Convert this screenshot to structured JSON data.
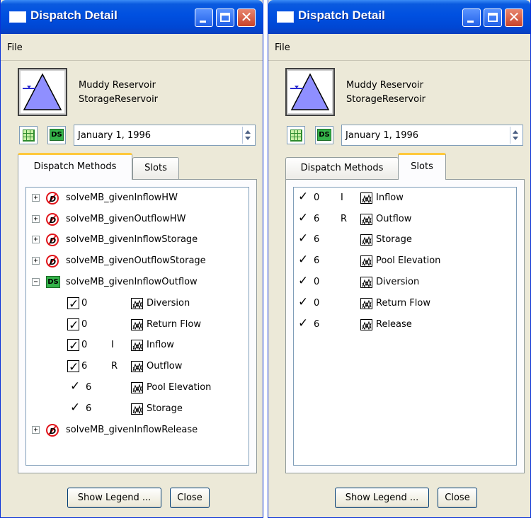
{
  "windows": [
    {
      "title": "Dispatch Detail",
      "menu": {
        "file_label": "File"
      },
      "object": {
        "name": "Muddy Reservoir",
        "type": "StorageReservoir"
      },
      "ds_label": "DS",
      "date": "January 1, 1996",
      "tabs": [
        {
          "label": "Dispatch Methods",
          "active": true
        },
        {
          "label": "Slots",
          "active": false
        }
      ],
      "tree": {
        "methods": [
          {
            "label": "solveMB_givenInflowHW",
            "expanded": false,
            "active": false
          },
          {
            "label": "solveMB_givenOutflowHW",
            "expanded": false,
            "active": false
          },
          {
            "label": "solveMB_givenInflowStorage",
            "expanded": false,
            "active": false
          },
          {
            "label": "solveMB_givenOutflowStorage",
            "expanded": false,
            "active": false
          },
          {
            "label": "solveMB_givenInflowOutflow",
            "expanded": true,
            "active": true
          },
          {
            "label": "solveMB_givenInflowRelease",
            "expanded": false,
            "active": false
          }
        ],
        "child_slots": [
          {
            "num": "0",
            "flag": "",
            "name": "Diversion",
            "boxed": true
          },
          {
            "num": "0",
            "flag": "",
            "name": "Return Flow",
            "boxed": true
          },
          {
            "num": "0",
            "flag": "I",
            "name": "Inflow",
            "boxed": true
          },
          {
            "num": "6",
            "flag": "R",
            "name": "Outflow",
            "boxed": true
          },
          {
            "num": "6",
            "flag": "",
            "name": "Pool Elevation",
            "boxed": false
          },
          {
            "num": "6",
            "flag": "",
            "name": "Storage",
            "boxed": false
          }
        ]
      },
      "buttons": {
        "legend": "Show Legend ...",
        "close": "Close"
      }
    },
    {
      "title": "Dispatch Detail",
      "menu": {
        "file_label": "File"
      },
      "object": {
        "name": "Muddy Reservoir",
        "type": "StorageReservoir"
      },
      "ds_label": "DS",
      "date": "January 1, 1996",
      "tabs": [
        {
          "label": "Dispatch Methods",
          "active": false
        },
        {
          "label": "Slots",
          "active": true
        }
      ],
      "slots": [
        {
          "num": "0",
          "flag": "I",
          "name": "Inflow"
        },
        {
          "num": "6",
          "flag": "R",
          "name": "Outflow"
        },
        {
          "num": "6",
          "flag": "",
          "name": "Storage"
        },
        {
          "num": "6",
          "flag": "",
          "name": "Pool Elevation"
        },
        {
          "num": "0",
          "flag": "",
          "name": "Diversion"
        },
        {
          "num": "0",
          "flag": "",
          "name": "Return Flow"
        },
        {
          "num": "6",
          "flag": "",
          "name": "Release"
        }
      ],
      "buttons": {
        "legend": "Show Legend ...",
        "close": "Close"
      }
    }
  ],
  "icons": {
    "check": "check-mark-icon",
    "slot": "series-slot-icon",
    "method_inactive": "no-dispatch-icon",
    "method_active": "ds-icon",
    "reservoir": "reservoir-triangle-icon",
    "grid": "grid-icon"
  },
  "colors": {
    "title_bar": "#0050e0",
    "close_button": "#c8432a",
    "ds_green": "#34b34a",
    "no_red": "#e0141a",
    "reservoir_fill": "#8f8fff",
    "tab_highlight": "#ffc83c"
  }
}
